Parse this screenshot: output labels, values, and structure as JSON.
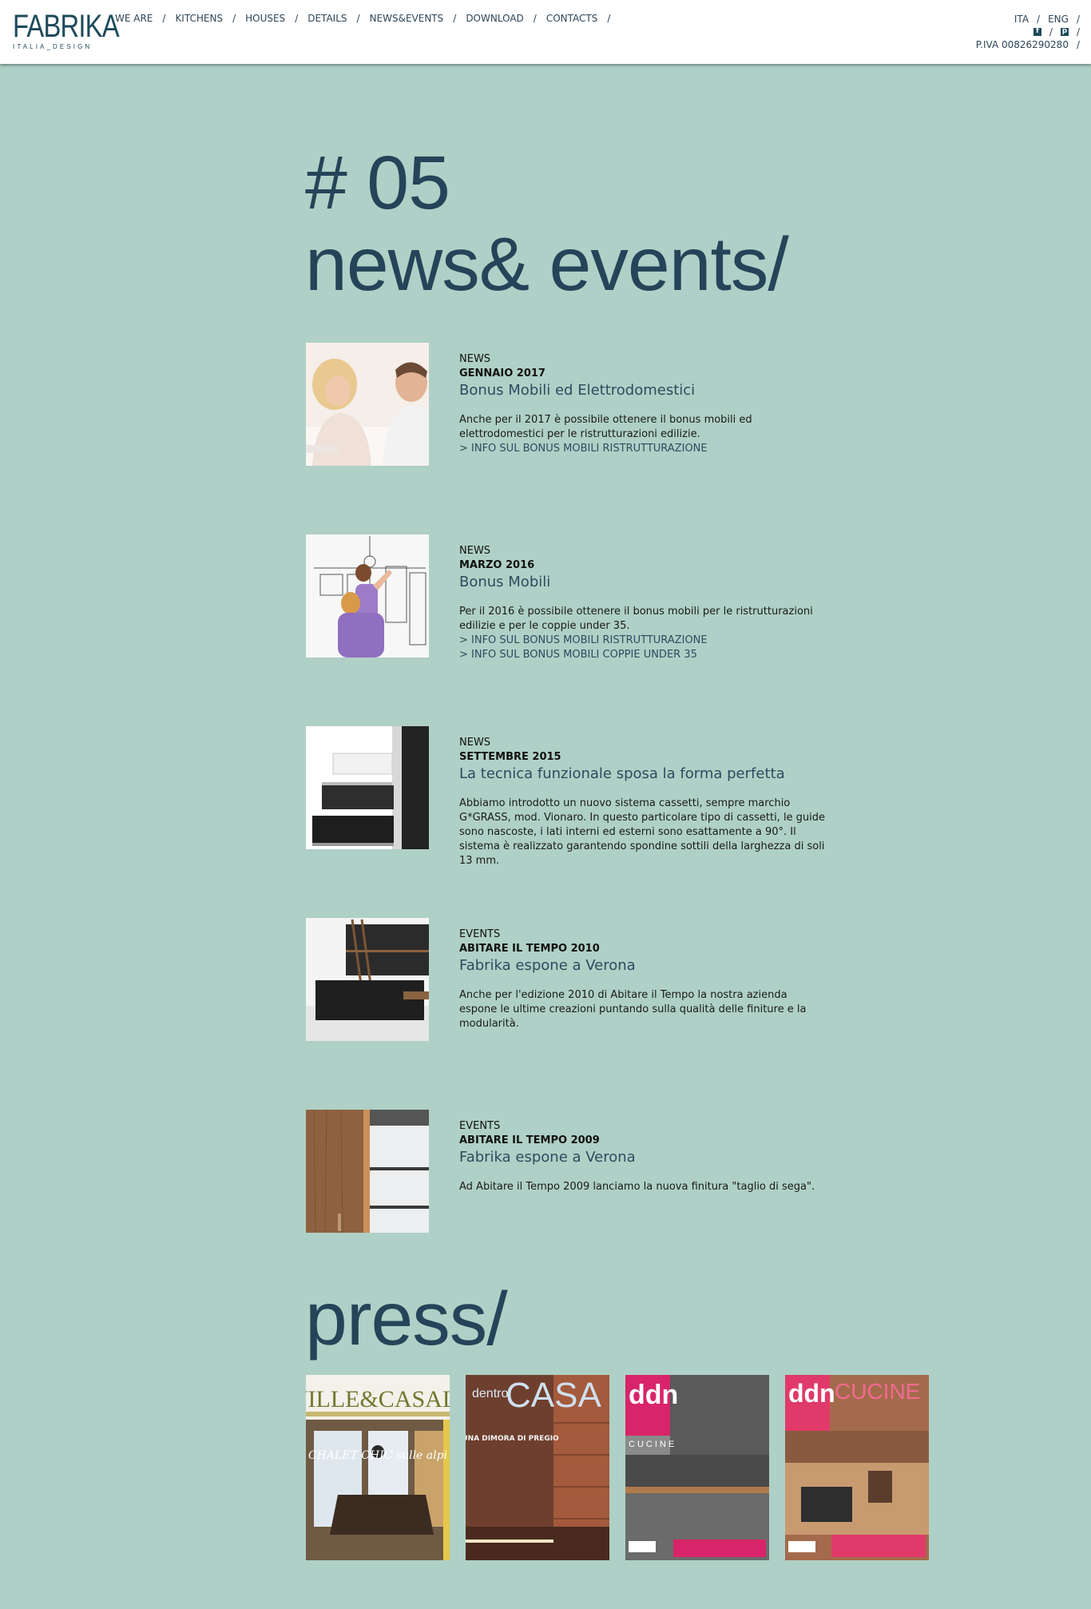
{
  "header": {
    "logo": {
      "main": "FABRIKA",
      "sub": "ITALIA_DESIGN"
    },
    "nav": [
      {
        "label": "WE ARE"
      },
      {
        "label": "KITCHENS"
      },
      {
        "label": "HOUSES"
      },
      {
        "label": "DETAILS"
      },
      {
        "label": "NEWS&EVENTS"
      },
      {
        "label": "DOWNLOAD"
      },
      {
        "label": "CONTACTS"
      }
    ],
    "separator": "/",
    "languages": [
      "ITA",
      "ENG"
    ],
    "social": [
      {
        "icon": "facebook-icon",
        "glyph": "f"
      },
      {
        "icon": "pinterest-icon",
        "glyph": "p"
      }
    ],
    "piva": "P.IVA 00826290280"
  },
  "page": {
    "number": "# 05",
    "title": "news& events/",
    "press_title": "press/"
  },
  "news": [
    {
      "type": "NEWS",
      "date": "GENNAIO 2017",
      "title": "Bonus Mobili ed Elettrodomestici",
      "body": "Anche per il 2017 è possibile ottenere il bonus mobili ed elettrodomestici per le ristrutturazioni edilizie.",
      "links": [
        "> INFO SUL BONUS MOBILI RISTRUTTURAZIONE"
      ]
    },
    {
      "type": "NEWS",
      "date": "MARZO 2016",
      "title": "Bonus Mobili",
      "body": "Per il 2016 è possibile ottenere il bonus mobili per le ristrutturazioni edilizie e per le coppie under 35.",
      "links": [
        "> INFO SUL BONUS MOBILI RISTRUTTURAZIONE",
        "> INFO SUL BONUS MOBILI COPPIE UNDER 35"
      ]
    },
    {
      "type": "NEWS",
      "date": "SETTEMBRE 2015",
      "title": "La tecnica funzionale sposa la forma perfetta",
      "body": "Abbiamo introdotto un nuovo sistema cassetti, sempre marchio G*GRASS, mod. Vionaro. In questo particolare tipo di cassetti, le guide sono nascoste, i lati interni ed esterni sono esattamente a 90°. Il sistema è realizzato garantendo spondine sottili della larghezza di soli 13 mm.",
      "links": []
    },
    {
      "type": "EVENTS",
      "date": "ABITARE IL TEMPO 2010",
      "title": "Fabrika espone a Verona",
      "body": "Anche per l'edizione 2010 di Abitare il Tempo la nostra azienda espone le ultime creazioni puntando sulla qualità delle finiture e la modularità.",
      "links": []
    },
    {
      "type": "EVENTS",
      "date": "ABITARE IL TEMPO 2009",
      "title": "Fabrika espone a Verona",
      "body": "Ad Abitare il Tempo 2009 lanciamo la nuova finitura \"taglio di sega\".",
      "links": []
    }
  ],
  "press": [
    {
      "masthead": "VILLE&CASALI",
      "cover_text": "CHALET CHIC sulle alpi"
    },
    {
      "masthead": "CASA",
      "kicker": "dentro",
      "cover_text": "UNA DIMORA DI PREGIO"
    },
    {
      "masthead": "ddn",
      "sub": "CUCINE"
    },
    {
      "masthead": "ddn",
      "sub": "CUCINE"
    }
  ]
}
